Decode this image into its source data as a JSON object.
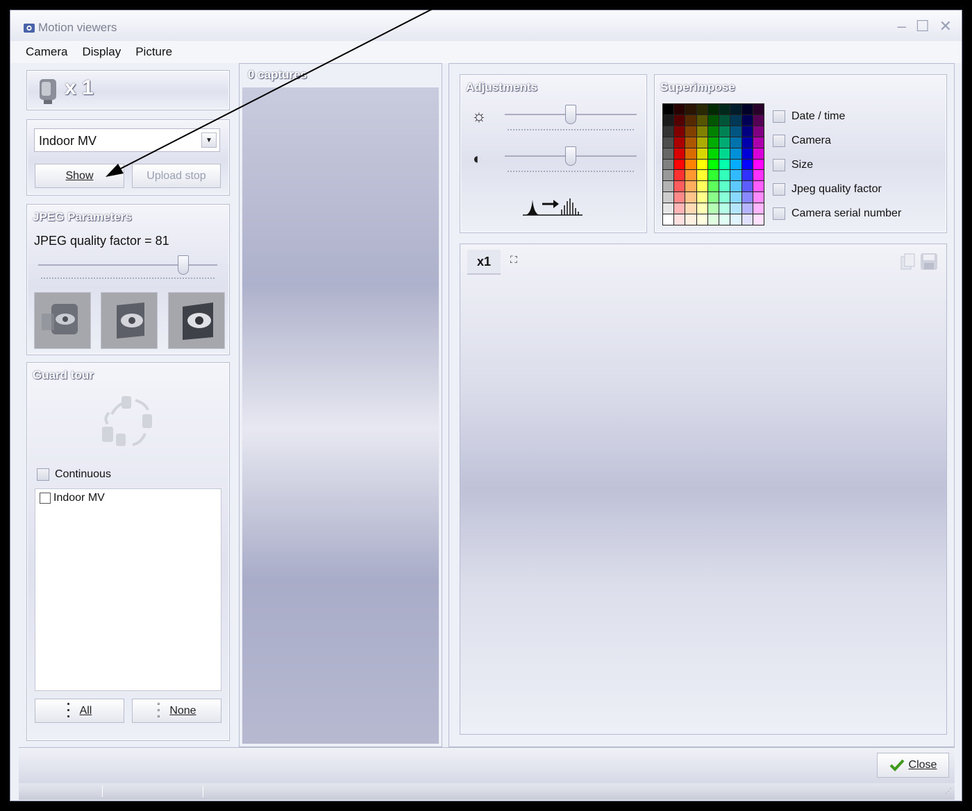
{
  "window": {
    "title": "Motion viewers"
  },
  "menu": [
    "Camera",
    "Display",
    "Picture"
  ],
  "camera_panel": {
    "count_label": "x 1"
  },
  "source": {
    "selected": "Indoor MV",
    "show_label": "Show",
    "upload_stop_label": "Upload stop"
  },
  "jpeg": {
    "title": "JPEG Parameters",
    "quality_text": "JPEG quality factor = 81",
    "quality_value": 81
  },
  "guard_tour": {
    "title": "Guard tour",
    "continuous_label": "Continuous",
    "cameras": [
      "Indoor MV"
    ],
    "all_label": "All",
    "none_label": "None"
  },
  "captures": {
    "title": "0 captures"
  },
  "adjustments": {
    "title": "Adjustments",
    "brightness": 50,
    "contrast": 50
  },
  "superimpose": {
    "title": "Superimpose",
    "options": [
      "Date / time",
      "Camera",
      "Size",
      "Jpeg quality factor",
      "Camera serial number"
    ]
  },
  "viewer": {
    "zoom_label": "x1"
  },
  "footer": {
    "close_label": "Close"
  },
  "colors": {
    "accent": "#3f9a1c",
    "panel": "#dfe1ee"
  }
}
